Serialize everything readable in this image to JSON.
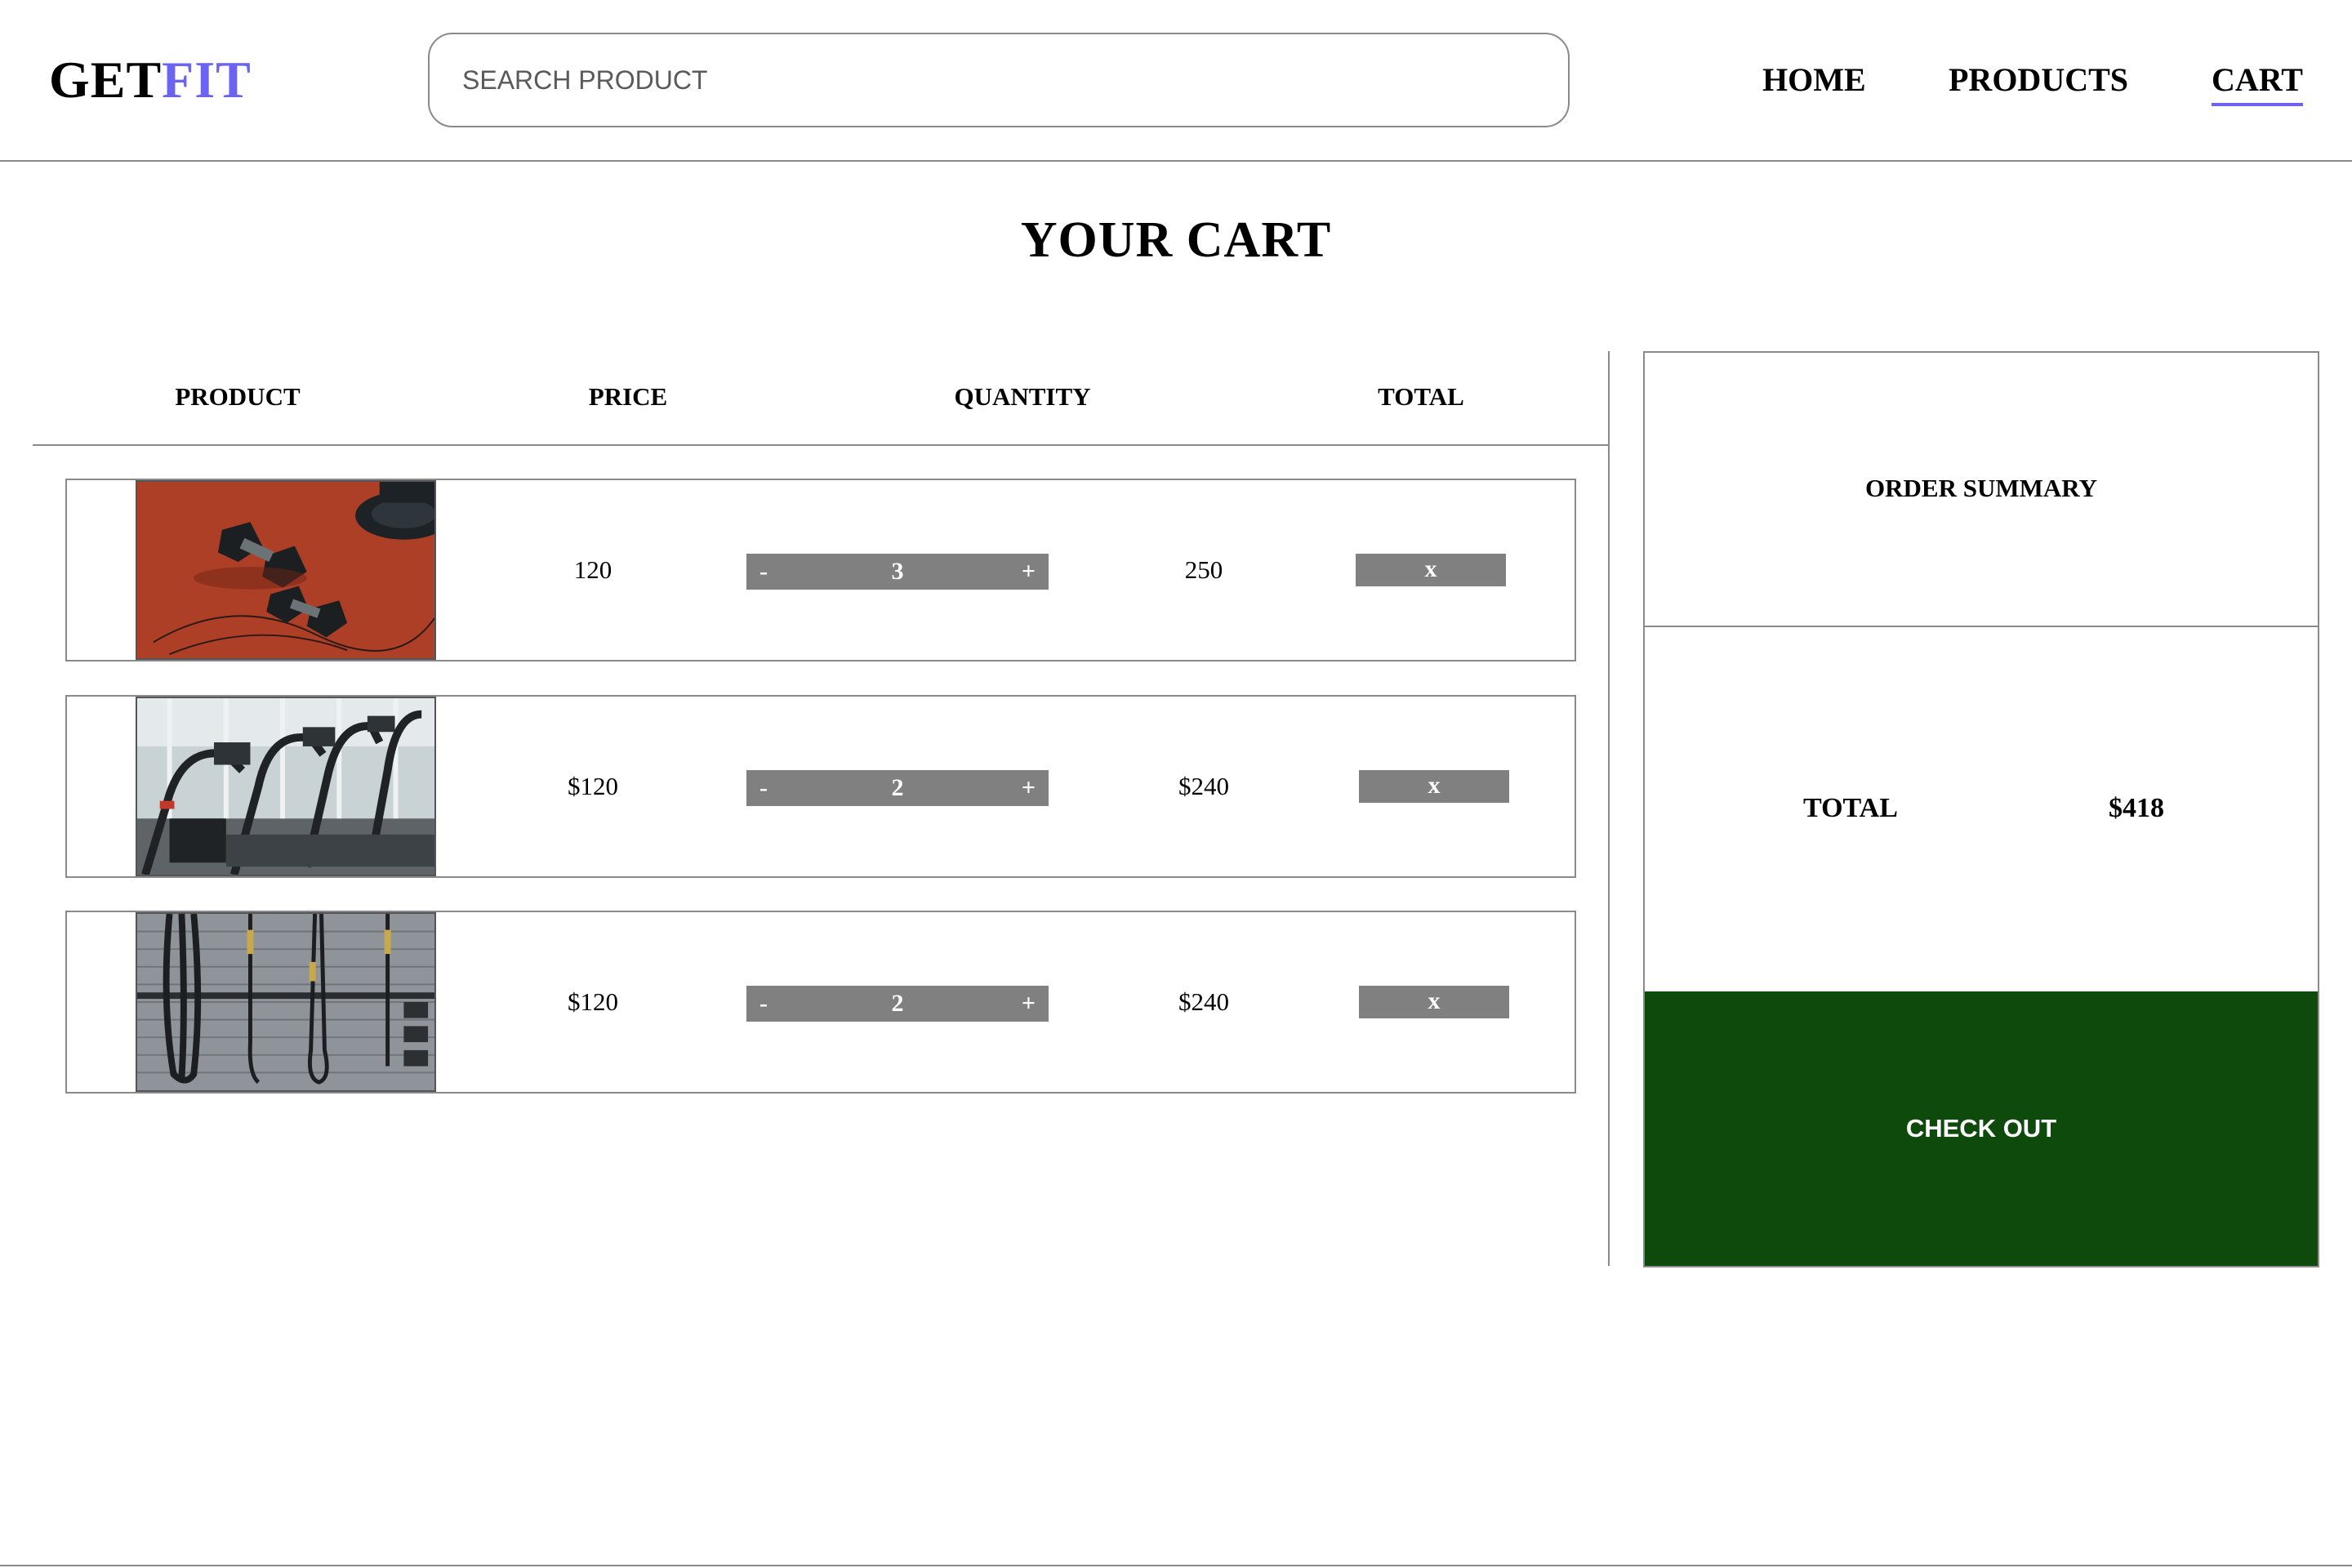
{
  "header": {
    "logo_part1": "GET",
    "logo_part2": "FIT",
    "search_placeholder": "SEARCH PRODUCT",
    "nav": {
      "home": "HOME",
      "products": "PRODUCTS",
      "cart": "CART"
    }
  },
  "page_title": "YOUR CART",
  "table": {
    "headers": {
      "product": "PRODUCT",
      "price": "PRICE",
      "quantity": "QUANTITY",
      "total": "TOTAL"
    },
    "rows": [
      {
        "image": "dumbbells-on-track-photo",
        "price": "120",
        "quantity": "3",
        "total": "250",
        "minus": "-",
        "plus": "+",
        "remove": "x"
      },
      {
        "image": "gym-treadmills-photo",
        "price": "$120",
        "quantity": "2",
        "total": "$240",
        "minus": "-",
        "plus": "+",
        "remove": "x"
      },
      {
        "image": "battle-ropes-wall-photo",
        "price": "$120",
        "quantity": "2",
        "total": "$240",
        "minus": "-",
        "plus": "+",
        "remove": "x"
      }
    ]
  },
  "summary": {
    "title": "ORDER SUMMARY",
    "total_label": "TOTAL",
    "total_value": "$418",
    "checkout_label": "CHECK OUT"
  },
  "colors": {
    "accent": "#6b63f4",
    "checkout_bg": "#0e4a0c",
    "control_bg": "#808080",
    "border": "#8a8a8a"
  }
}
